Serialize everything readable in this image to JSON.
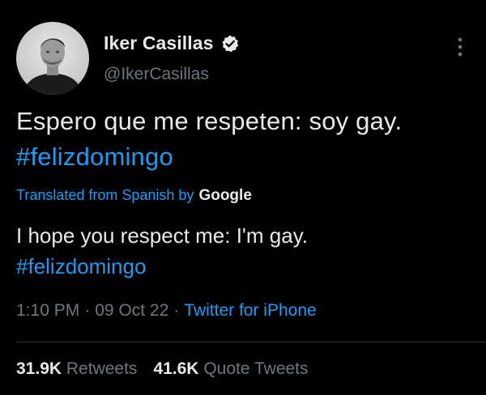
{
  "user": {
    "display_name": "Iker Casillas",
    "handle": "@IkerCasillas",
    "verified": true,
    "avatar_icon": "profile-photo"
  },
  "tweet": {
    "text_line1": "Espero que me respeten: soy gay.",
    "hashtag": "#felizdomingo"
  },
  "translation": {
    "label": "Translated from Spanish by",
    "provider": "Google",
    "text_line1": "I hope you respect me: I'm gay.",
    "hashtag": "#felizdomingo"
  },
  "meta": {
    "time": "1:10 PM",
    "separator": "·",
    "date": "09 Oct 22",
    "source": "Twitter for iPhone"
  },
  "stats": {
    "retweets_count": "31.9K",
    "retweets_label": "Retweets",
    "quotes_count": "41.6K",
    "quotes_label": "Quote Tweets"
  },
  "colors": {
    "background": "#000000",
    "text": "#e7e9ea",
    "muted": "#71767b",
    "accent": "#1d9bf0",
    "divider": "#2f3336"
  },
  "icons": {
    "verified": "verified-badge-icon",
    "more": "more-options-icon"
  }
}
